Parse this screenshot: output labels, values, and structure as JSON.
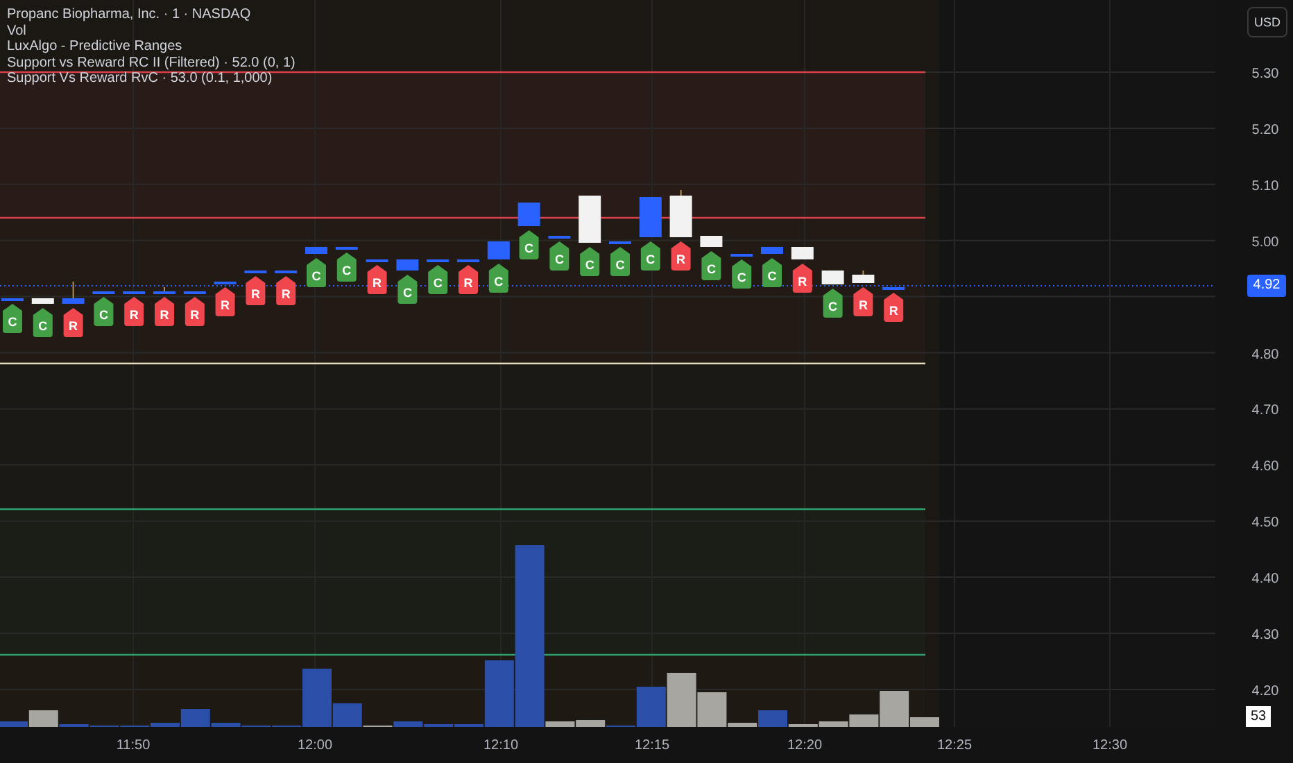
{
  "legend": [
    {
      "text": "Propanc Biopharma, Inc. · 1 · NASDAQ"
    },
    {
      "text": "Vol"
    },
    {
      "text": "LuxAlgo - Predictive Ranges"
    },
    {
      "text": "Support vs Reward RC II (Filtered) · 52.0 (0, 1)"
    },
    {
      "text": "Support Vs Reward RvC · 53.0 (0.1, 1,000)"
    }
  ],
  "currency_button": {
    "label": "USD"
  },
  "price_axis": {
    "labels": [
      "5.30",
      "5.20",
      "5.10",
      "5.00",
      "4.80",
      "4.70",
      "4.60",
      "4.50",
      "4.40",
      "4.30",
      "4.20"
    ],
    "last_price": "4.92",
    "volume_value": "53"
  },
  "time_axis": {
    "labels": [
      "11:50",
      "12:00",
      "12:10",
      "12:15",
      "12:20",
      "12:25",
      "12:30"
    ]
  },
  "markers": [
    {
      "label": "C",
      "color": "#43a047"
    },
    {
      "label": "C",
      "color": "#43a047"
    },
    {
      "label": "R",
      "color": "#f0474f"
    },
    {
      "label": "C",
      "color": "#43a047"
    },
    {
      "label": "R",
      "color": "#f0474f"
    },
    {
      "label": "R",
      "color": "#f0474f"
    },
    {
      "label": "R",
      "color": "#f0474f"
    },
    {
      "label": "R",
      "color": "#f0474f"
    },
    {
      "label": "R",
      "color": "#f0474f"
    },
    {
      "label": "R",
      "color": "#f0474f"
    },
    {
      "label": "C",
      "color": "#43a047"
    },
    {
      "label": "C",
      "color": "#43a047"
    },
    {
      "label": "R",
      "color": "#f0474f"
    },
    {
      "label": "C",
      "color": "#43a047"
    },
    {
      "label": "C",
      "color": "#43a047"
    },
    {
      "label": "R",
      "color": "#f0474f"
    },
    {
      "label": "C",
      "color": "#43a047"
    },
    {
      "label": "C",
      "color": "#43a047"
    },
    {
      "label": "C",
      "color": "#43a047"
    },
    {
      "label": "C",
      "color": "#43a047"
    },
    {
      "label": "C",
      "color": "#43a047"
    },
    {
      "label": "C",
      "color": "#43a047"
    },
    {
      "label": "R",
      "color": "#f0474f"
    },
    {
      "label": "C",
      "color": "#43a047"
    },
    {
      "label": "C",
      "color": "#43a047"
    },
    {
      "label": "C",
      "color": "#43a047"
    },
    {
      "label": "R",
      "color": "#f0474f"
    },
    {
      "label": "C",
      "color": "#43a047"
    },
    {
      "label": "R",
      "color": "#f0474f"
    },
    {
      "label": "R",
      "color": "#f0474f"
    }
  ]
}
